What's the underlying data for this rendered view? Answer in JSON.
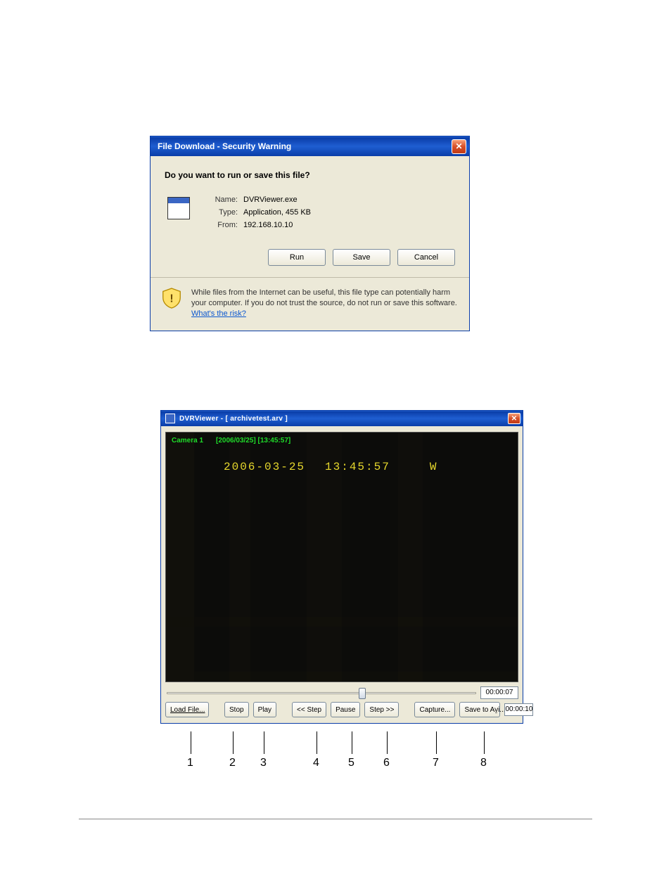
{
  "download_dialog": {
    "title": "File Download - Security Warning",
    "prompt": "Do you want to run or save this file?",
    "labels": {
      "name": "Name:",
      "type": "Type:",
      "from": "From:"
    },
    "values": {
      "name": "DVRViewer.exe",
      "type": "Application, 455 KB",
      "from": "192.168.10.10"
    },
    "buttons": {
      "run": "Run",
      "save": "Save",
      "cancel": "Cancel"
    },
    "warning_text": "While files from the Internet can be useful, this file type can potentially harm your computer. If you do not trust the source, do not run or save this software. ",
    "risk_link": "What's the risk?"
  },
  "viewer": {
    "title": "DVRViewer - [ archivetest.arv ]",
    "osd": {
      "camera": "Camera 1",
      "stamp": "[2006/03/25] [13:45:57]",
      "overlay_date": "2006-03-25",
      "overlay_time": "13:45:57",
      "overlay_flag": "W"
    },
    "time_current": "00:00:07",
    "time_total": "00:00:10",
    "buttons": {
      "load": "Load File...",
      "stop": "Stop",
      "play": "Play",
      "step_back": "<< Step",
      "pause": "Pause",
      "step_fwd": "Step >>",
      "capture": "Capture...",
      "save_avi": "Save to Av̱i..."
    }
  },
  "callouts": {
    "1": "1",
    "2": "2",
    "3": "3",
    "4": "4",
    "5": "5",
    "6": "6",
    "7": "7",
    "8": "8"
  }
}
